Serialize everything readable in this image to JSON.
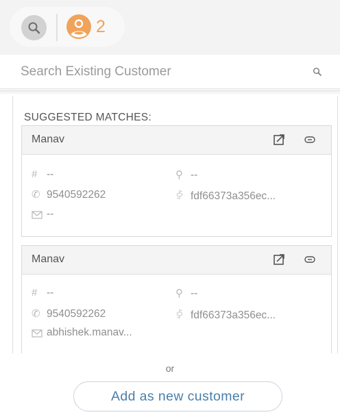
{
  "header": {
    "search_icon": "search-icon",
    "user_icon": "user-circle-icon",
    "user_count": "2"
  },
  "search": {
    "placeholder": "Search Existing Customer",
    "value": ""
  },
  "suggestions": {
    "label": "SUGGESTED MATCHES:",
    "cards": [
      {
        "name": "Manav",
        "id": "--",
        "phone": "9540592262",
        "email": "--",
        "pin": "--",
        "twitter": "fdf66373a356ec..."
      },
      {
        "name": "Manav",
        "id": "--",
        "phone": "9540592262",
        "email": "abhishek.manav...",
        "pin": "--",
        "twitter": "fdf66373a356ec..."
      }
    ]
  },
  "footer": {
    "or_text": "or",
    "add_button_label": "Add as new customer"
  },
  "colors": {
    "accent_orange": "#f0a35a",
    "button_text": "#4a7ea8",
    "muted_text": "#8f8f8f"
  }
}
